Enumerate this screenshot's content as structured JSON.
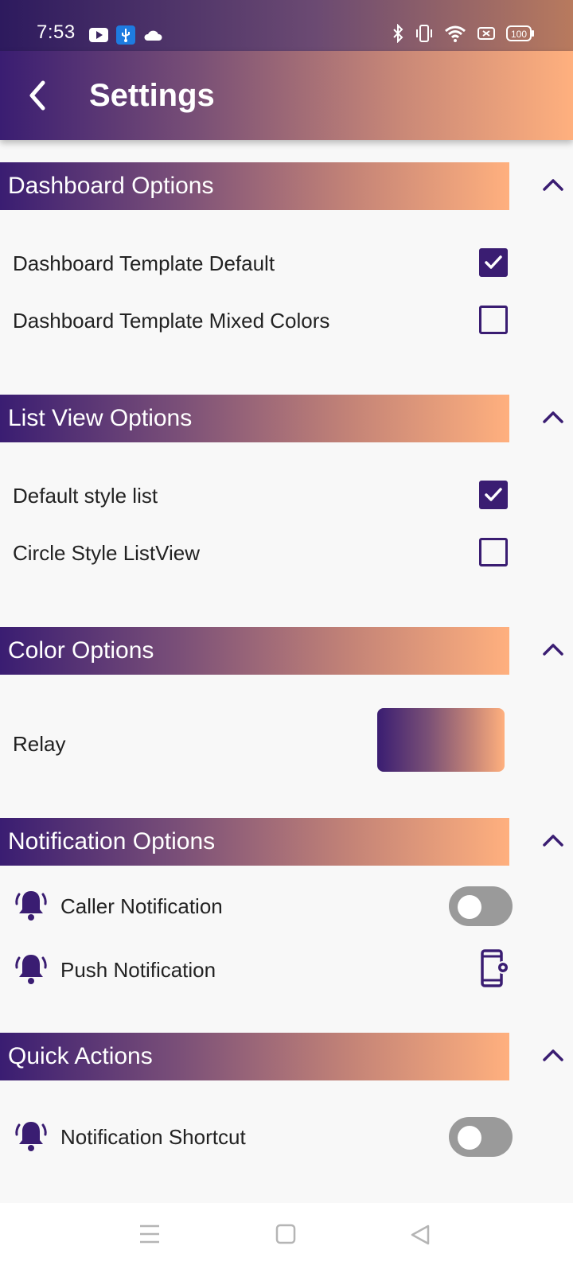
{
  "status_bar": {
    "time": "7:53",
    "battery": "100",
    "icons": [
      "youtube-icon",
      "usb-icon",
      "cloud-icon",
      "bluetooth-icon",
      "vibrate-icon",
      "wifi-icon",
      "battery-saver-icon",
      "battery-icon"
    ]
  },
  "app_bar": {
    "title": "Settings",
    "back_icon": "back-arrow-icon"
  },
  "colors": {
    "primary": "#3a1d72",
    "gradient_end": "#ffb07e",
    "toggle_off": "#9a9a9a"
  },
  "sections": {
    "dashboard": {
      "title": "Dashboard Options",
      "items": [
        {
          "label": "Dashboard Template Default",
          "checked": true
        },
        {
          "label": "Dashboard Template Mixed Colors",
          "checked": false
        }
      ]
    },
    "list_view": {
      "title": "List View Options",
      "items": [
        {
          "label": "Default style list",
          "checked": true
        },
        {
          "label": "Circle Style ListView",
          "checked": false
        }
      ]
    },
    "color": {
      "title": "Color Options",
      "items": [
        {
          "label": "Relay"
        }
      ]
    },
    "notification": {
      "title": "Notification Options",
      "items": [
        {
          "label": "Caller Notification",
          "toggle_on": false
        },
        {
          "label": "Push Notification"
        }
      ]
    },
    "quick_actions": {
      "title": "Quick Actions",
      "items": [
        {
          "label": "Notification Shortcut",
          "toggle_on": false
        }
      ]
    }
  },
  "nav_bar": {
    "icons": [
      "menu-icon",
      "home-square-icon",
      "back-triangle-icon"
    ]
  }
}
